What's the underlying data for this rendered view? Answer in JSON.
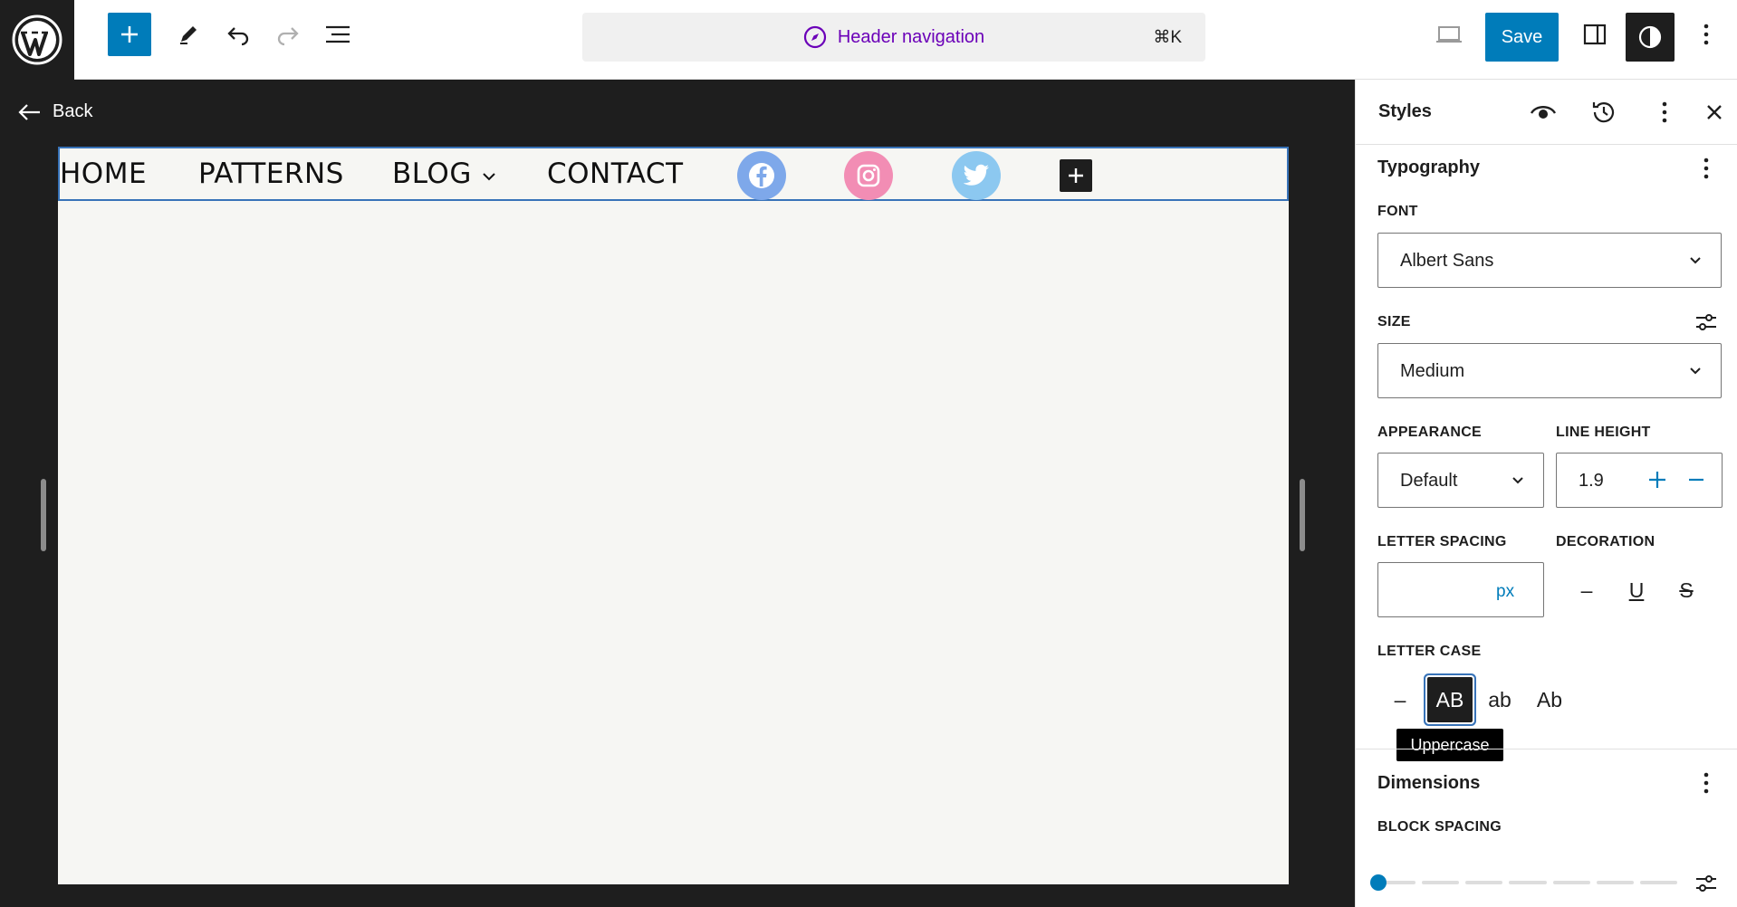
{
  "topbar": {
    "command_title": "Header navigation",
    "command_shortcut": "⌘K",
    "save_label": "Save"
  },
  "canvas": {
    "back_label": "Back",
    "nav_items": [
      "HOME",
      "PATTERNS",
      "BLOG",
      "CONTACT"
    ],
    "social": [
      {
        "icon": "facebook-icon",
        "color": "#7ea8ea"
      },
      {
        "icon": "instagram-icon",
        "color": "#f28db4"
      },
      {
        "icon": "twitter-icon",
        "color": "#8cc8f0"
      }
    ]
  },
  "sidebar": {
    "title": "Styles",
    "typography": {
      "title": "Typography",
      "font_label": "FONT",
      "font_value": "Albert Sans",
      "size_label": "SIZE",
      "size_value": "Medium",
      "appearance_label": "APPEARANCE",
      "appearance_value": "Default",
      "line_height_label": "LINE HEIGHT",
      "line_height_value": "1.9",
      "letter_spacing_label": "LETTER SPACING",
      "letter_spacing_unit": "px",
      "decoration_label": "DECORATION",
      "decoration_options": [
        "–",
        "U",
        "S"
      ],
      "letter_case_label": "LETTER CASE",
      "letter_case_options": [
        "–",
        "AB",
        "ab",
        "Ab"
      ],
      "letter_case_selected": "AB",
      "tooltip": "Uppercase"
    },
    "dimensions": {
      "title": "Dimensions",
      "block_spacing_label": "BLOCK SPACING"
    }
  },
  "colors": {
    "accent": "#007cba",
    "dark": "#1e1e1e",
    "command_purple": "#6b00b8"
  }
}
